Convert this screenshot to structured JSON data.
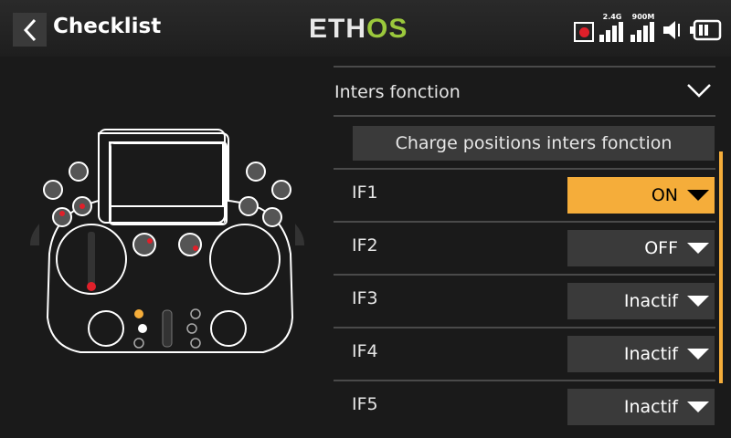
{
  "header": {
    "title": "Checklist",
    "logo_left": "ETH",
    "logo_right": "OS",
    "status": {
      "signal1_label": "2.4G",
      "signal2_label": "900M",
      "icons": [
        "record-icon",
        "signal-icon",
        "signal-icon",
        "speaker-icon",
        "battery-icon"
      ]
    }
  },
  "section": {
    "title": "Inters fonction",
    "load_button": "Charge positions inters fonction"
  },
  "rows": [
    {
      "label": "IF1",
      "value": "ON",
      "highlight": true
    },
    {
      "label": "IF2",
      "value": "OFF",
      "highlight": false
    },
    {
      "label": "IF3",
      "value": "Inactif",
      "highlight": false
    },
    {
      "label": "IF4",
      "value": "Inactif",
      "highlight": false
    },
    {
      "label": "IF5",
      "value": "Inactif",
      "highlight": false
    }
  ],
  "colors": {
    "accent": "#f5ad3a",
    "logo_green": "#9bc83c",
    "background": "#1a1a1a",
    "control_bg": "#3a3a3a",
    "red_indicator": "#e0202a"
  }
}
